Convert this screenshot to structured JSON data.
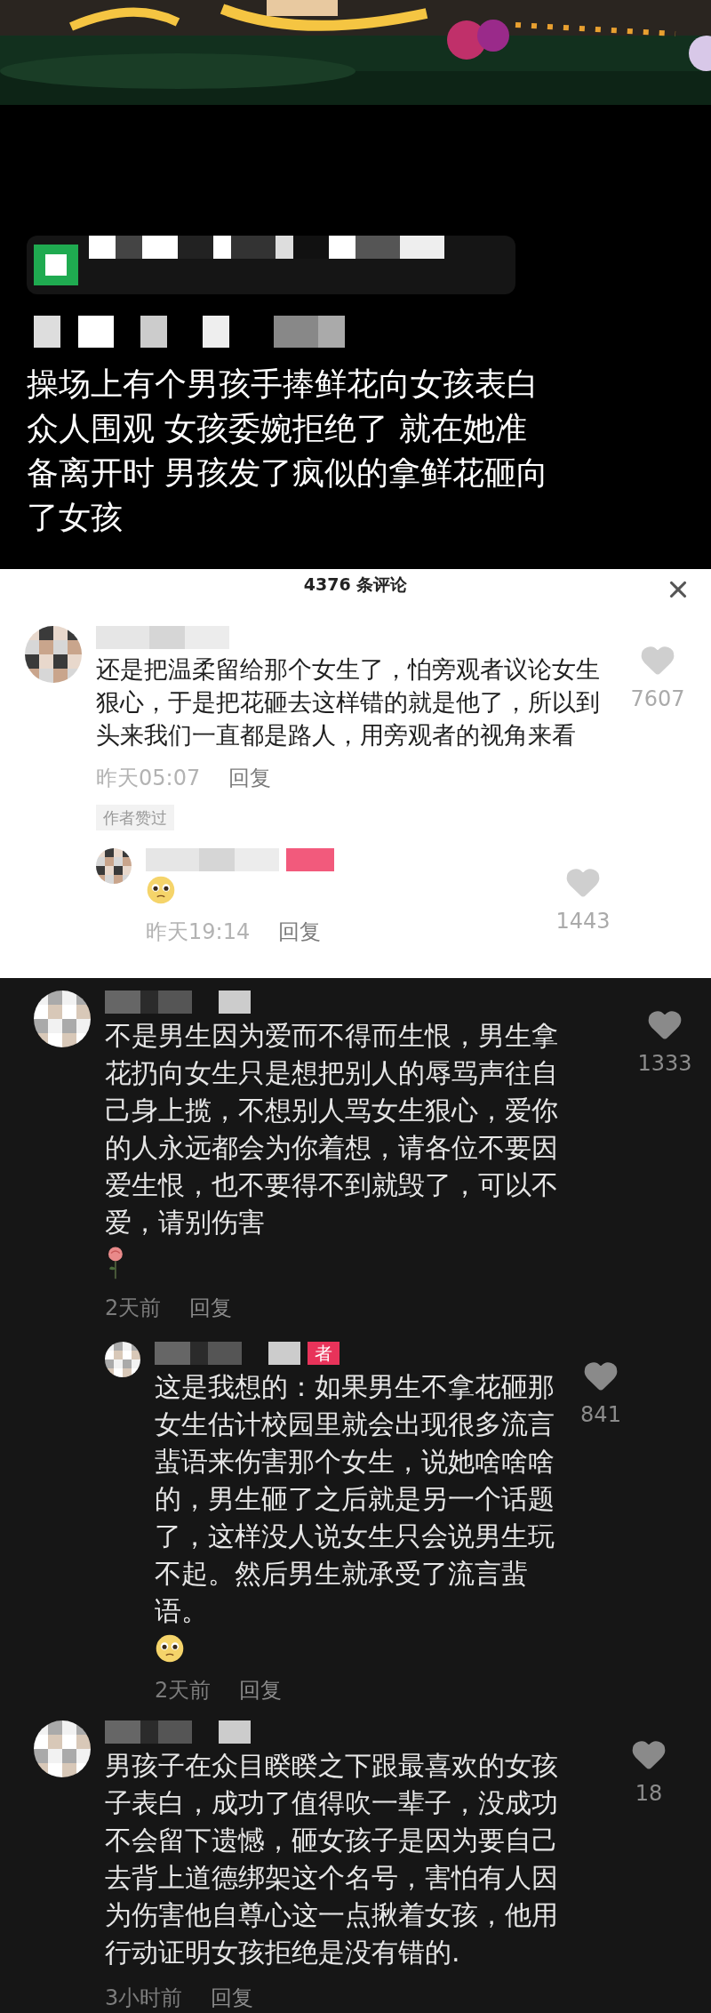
{
  "video": {
    "kind": "picture",
    "caption": "操场上有个男孩手捧鲜花向女孩表白众人围观 女孩委婉拒绝了 就在她准备离开时 男孩发了疯似的拿鲜花砸向了女孩"
  },
  "comments_panel": {
    "title": "4376 条评论"
  },
  "light_comments": [
    {
      "text": "还是把温柔留给那个女生了，怕旁观者议论女生狠心，于是把花砸去这样错的就是他了，所以到头来我们一直都是路人，用旁观者的视角来看",
      "likes": "7607",
      "time": "昨天05:07",
      "reply_label": "回复",
      "badge": "作者赞过",
      "replies": [
        {
          "sticker": {
            "kind": "pleading"
          },
          "likes": "1443",
          "time": "昨天19:14",
          "reply_label": "回复"
        }
      ]
    }
  ],
  "dark_comments": [
    {
      "text": "不是男生因为爱而不得而生恨，男生拿花扔向女生只是想把别人的辱骂声往自己身上揽，不想别人骂女生狠心，爱你的人永远都会为你着想，请各位不要因爱生恨，也不要得不到就毁了，可以不爱，请别伤害",
      "sticker": {
        "kind": "rose"
      },
      "likes": "1333",
      "time": "2天前",
      "reply_label": "回复",
      "replies": [
        {
          "author_badge": "者",
          "text": "这是我想的：如果男生不拿花砸那女生估计校园里就会出现很多流言蜚语来伤害那个女生，说她啥啥啥的，男生砸了之后就是另一个话题了，这样没人说女生只会说男生玩不起。然后男生就承受了流言蜚语。",
          "sticker": {
            "kind": "pleading"
          },
          "likes": "841",
          "time": "2天前",
          "reply_label": "回复"
        }
      ]
    },
    {
      "text": "男孩子在众目睽睽之下跟最喜欢的女孩子表白，成功了值得吹一辈子，没成功不会留下遗憾，砸女孩子是因为要自己去背上道德绑架这个名号，害怕有人因为伤害他自尊心这一点揪着女孩，他用行动证明女孩拒绝是没有错的.",
      "likes": "18",
      "time": "3小时前",
      "reply_label": "回复"
    }
  ]
}
